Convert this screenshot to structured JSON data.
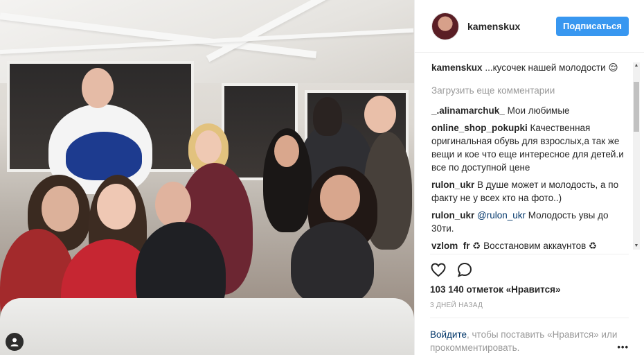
{
  "header": {
    "username": "kamenskux",
    "follow_label": "Подписаться"
  },
  "caption": {
    "username": "kamenskux",
    "text": "...кусочек нашей молодости 😌"
  },
  "load_more_label": "Загрузить еще комментарии",
  "comments": [
    {
      "username": "_.alinamarchuk_",
      "text": "Мои любимые"
    },
    {
      "username": "online_shop_pokupki",
      "text": "Качественная оригинальная обувь для взрослых,а так же вещи и кое что еще интересное для детей.и все по доступной цене"
    },
    {
      "username": "rulon_ukr",
      "text": "В душе может и молодость, а по факту не у всех кто на фото..)"
    },
    {
      "username": "rulon_ukr",
      "mention": "@rulon_ukr",
      "text": " Молодость увы до 30ти."
    },
    {
      "username": "vzlom_fr",
      "text": "♻ Восстановим аккаунтов ♻"
    }
  ],
  "likes_text": "103 140 отметок «Нравится»",
  "time_text": "3 ДНЕЙ НАЗАД",
  "footer": {
    "login_label": "Войдите",
    "rest_text": ", чтобы поставить «Нравится» или прокомментировать.",
    "more_label": "•••"
  },
  "icons": {
    "like": "heart-icon",
    "comment": "comment-icon",
    "user_tag": "user-tag-icon"
  },
  "colors": {
    "accent": "#3897f0",
    "link": "#003569",
    "muted": "#999999"
  }
}
